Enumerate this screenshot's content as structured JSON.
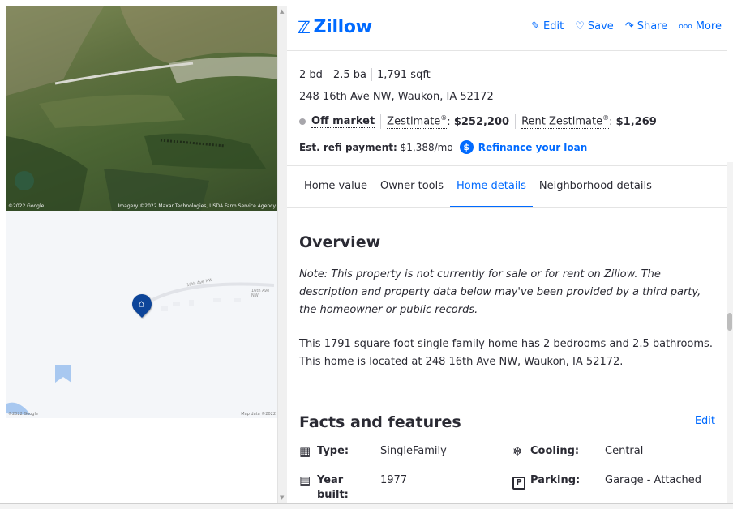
{
  "map": {
    "aerial_credit_left": "©2022 Google",
    "aerial_credit_right": "Imagery ©2022 Maxar Technologies, USDA Farm Service Agency",
    "map_credit_left": "©2022 Google",
    "map_credit_right": "Map data ©2022",
    "road_label_1": "16th Ave NW",
    "road_label_2": "16th Ave NW",
    "pin_icon": "home-icon"
  },
  "header": {
    "logo": "Zillow",
    "logo_icon": "zillow-z-icon",
    "actions": [
      {
        "label": "Edit",
        "icon": "pencil-icon"
      },
      {
        "label": "Save",
        "icon": "heart-icon"
      },
      {
        "label": "Share",
        "icon": "share-arrow-icon"
      },
      {
        "label": "More",
        "icon": "more-dots-icon"
      }
    ]
  },
  "summary": {
    "beds": "2 bd",
    "baths": "2.5 ba",
    "sqft": "1,791 sqft",
    "address": "248 16th Ave NW, Waukon, IA 52172",
    "status": "Off market",
    "zestimate_label": "Zestimate",
    "zestimate_value": "$252,200",
    "rent_label": "Rent Zestimate",
    "rent_value": "$1,269",
    "reg_mark": "®",
    "refi_label": "Est. refi payment:",
    "refi_value": "$1,388/mo",
    "refi_link": "Refinance your loan"
  },
  "tabs": [
    "Home value",
    "Owner tools",
    "Home details",
    "Neighborhood details"
  ],
  "active_tab": "Home details",
  "overview": {
    "title": "Overview",
    "note": "Note: This property is not currently for sale or for rent on Zillow. The description and property data below may've been provided by a third party, the homeowner or public records.",
    "description": "This 1791 square foot single family home has 2 bedrooms and 2.5 bathrooms. This home is located at 248 16th Ave NW, Waukon, IA 52172."
  },
  "facts": {
    "title": "Facts and features",
    "edit": "Edit",
    "items": [
      {
        "label": "Type:",
        "value": "SingleFamily",
        "icon": "building-icon"
      },
      {
        "label": "Cooling:",
        "value": "Central",
        "icon": "snowflake-icon"
      },
      {
        "label": "Year built:",
        "value": "1977",
        "icon": "calendar-icon"
      },
      {
        "label": "Parking:",
        "value": "Garage - Attached",
        "icon": "parking-icon"
      }
    ]
  },
  "colors": {
    "brand": "#006aff",
    "pin": "#0d4599",
    "text": "#2a2a33"
  }
}
